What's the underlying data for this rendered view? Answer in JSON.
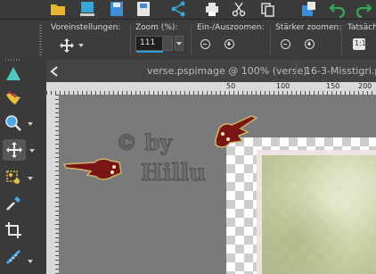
{
  "options_bar": {
    "presets_label": "Voreinstellungen:",
    "zoom_label": "Zoom (%):",
    "zoom_value": "111",
    "zoom_in_out_label": "Ein-/Auszoomen:",
    "stronger_zoom_label": "Stärker zoomen:",
    "cut_off_label": "Tatsäch"
  },
  "tabs": [
    {
      "label": "verse.pspimage @ 100% (verse)"
    },
    {
      "label": "16-3-Misstigri.ps"
    }
  ],
  "ruler": {
    "ticks": [
      "50",
      "100",
      "150",
      "200",
      "250"
    ]
  },
  "watermark": {
    "text_line1": "© by",
    "text_line2": "Hillu"
  },
  "colors": {
    "app_bg": "#2b2b2b",
    "accent": "#2f9bd8",
    "hand_fill": "#7a1515"
  }
}
